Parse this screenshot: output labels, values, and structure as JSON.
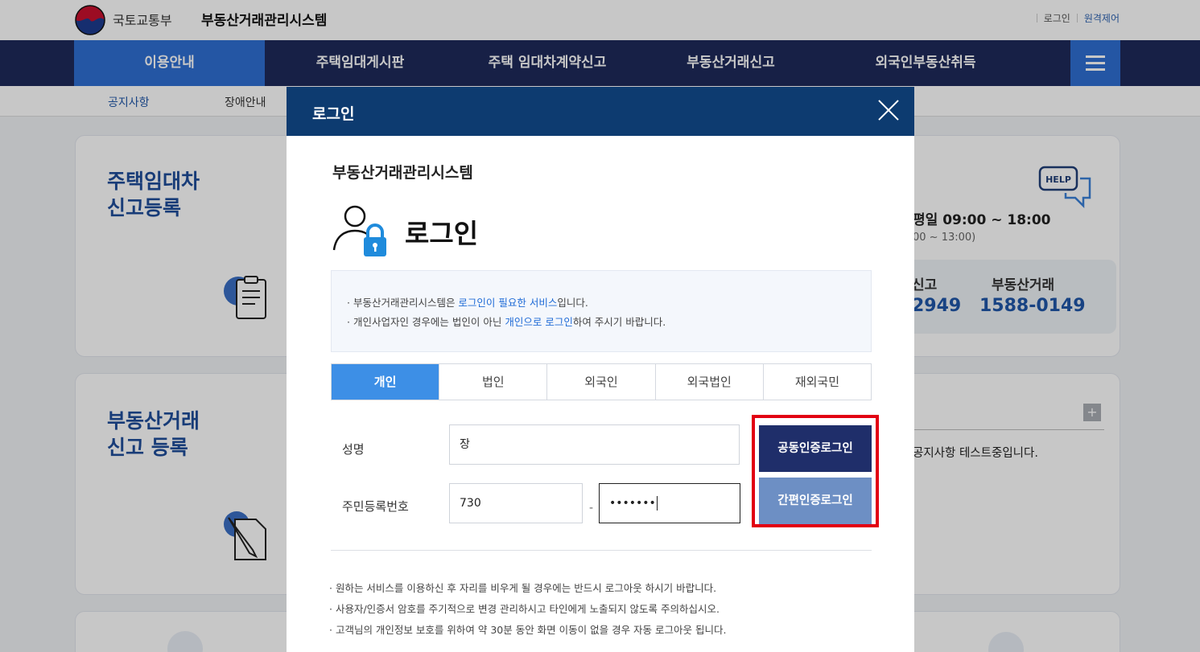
{
  "header": {
    "ministry": "국토교통부",
    "system": "부동산거래관리시스템",
    "login_link": "로그인",
    "remote_link": "원격제어"
  },
  "gnb": {
    "items": [
      "이용안내",
      "주택임대게시판",
      "주택 임대차계약신고",
      "부동산거래신고",
      "외국인부동산취득"
    ],
    "menu_icon": "hamburger-menu-icon"
  },
  "subnav": {
    "items": [
      "공지사항",
      "장애안내"
    ]
  },
  "background": {
    "card1_title": "주택임대차\n신고등록",
    "card2_title": "부동산거래\n신고 등록",
    "hours": "평일 09:00 ~ 18:00",
    "lunch": "00 ~ 13:00)",
    "phone_label_1": "신고",
    "phone_num_1": "2949",
    "phone_label_2": "부동산거래",
    "phone_num_2": "1588-0149",
    "notice_text": "공지사항 테스트중입니다.",
    "help_badge": "HELP",
    "plus_icon": "+"
  },
  "modal": {
    "title": "로그인",
    "system": "부동산거래관리시스템",
    "heading": "로그인",
    "notice": {
      "line1_pre": "· 부동산거래관리시스템은 ",
      "line1_hl": "로그인이 필요한 서비스",
      "line1_post": "입니다.",
      "line2_pre": "· 개인사업자인 경우에는 법인이 아닌 ",
      "line2_hl": "개인으로 로그인",
      "line2_post": "하여 주시기 바랍니다."
    },
    "tabs": [
      "개인",
      "법인",
      "외국인",
      "외국법인",
      "재외국민"
    ],
    "active_tab": "개인",
    "form": {
      "name_label": "성명",
      "name_value": "장",
      "rrn_label": "주민등록번호",
      "rrn_front": "730",
      "rrn_dash": "-",
      "rrn_back": "•••••••"
    },
    "buttons": {
      "cert_login": "공동인증로그인",
      "simple_login": "간편인증로그인"
    },
    "bottom_notes": [
      "· 원하는 서비스를 이용하신 후 자리를 비우게 될 경우에는 반드시 로그아웃 하시기 바랍니다.",
      "· 사용자/인증서 암호를 주기적으로 변경 관리하시고 타인에게 노출되지 않도록 주의하십시오.",
      "· 고객님의 개인정보 보호를 위하여 약 30분 동안 화면 이동이 없을 경우 자동 로그아웃 됩니다."
    ]
  },
  "colors": {
    "gnb_bg": "#1e2a5a",
    "accent_blue": "#2f6fd3",
    "modal_header": "#0d3b70",
    "cert_button": "#1f2e6a",
    "simple_button": "#6d8fc4",
    "highlight": "#e20012"
  }
}
